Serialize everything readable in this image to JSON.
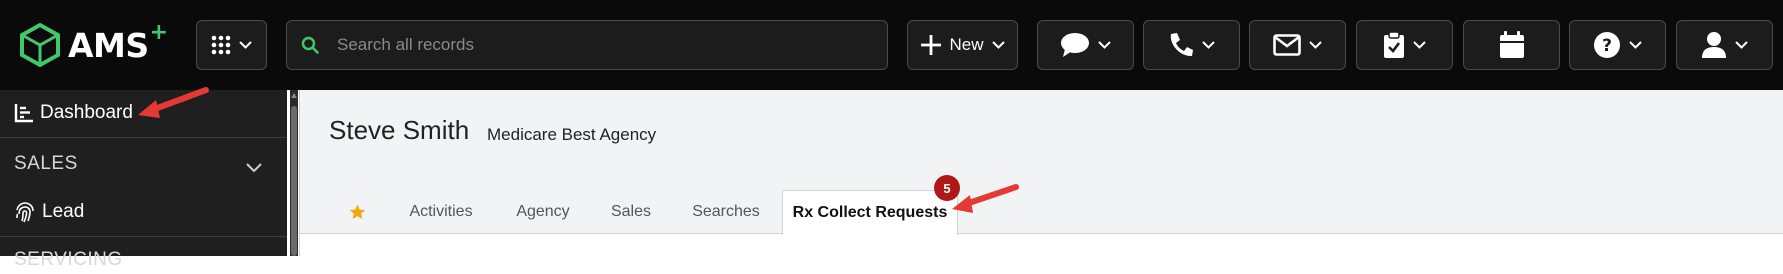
{
  "app": {
    "logo_text": "AMS",
    "logo_plus": "+"
  },
  "topbar": {
    "search_placeholder": "Search all records",
    "new_label": "New",
    "icons": [
      "apps-grid-icon",
      "chat-icon",
      "phone-icon",
      "mail-icon",
      "clipboard-check-icon",
      "calendar-icon",
      "help-icon",
      "user-icon"
    ]
  },
  "sidebar": {
    "dashboard_label": "Dashboard",
    "sales_section": "SALES",
    "lead_label": "Lead",
    "servicing_section": "SERVICING"
  },
  "main": {
    "person_name": "Steve Smith",
    "agency_name": "Medicare Best Agency",
    "tabs": [
      {
        "label": "Activities"
      },
      {
        "label": "Agency"
      },
      {
        "label": "Sales"
      },
      {
        "label": "Searches"
      },
      {
        "label": "Rx Collect Requests"
      }
    ],
    "badge_count": "5"
  },
  "colors": {
    "brand_green": "#42c86a",
    "annotation_red": "#e53935",
    "badge_red": "#b01818",
    "star_gold": "#f0a810"
  }
}
